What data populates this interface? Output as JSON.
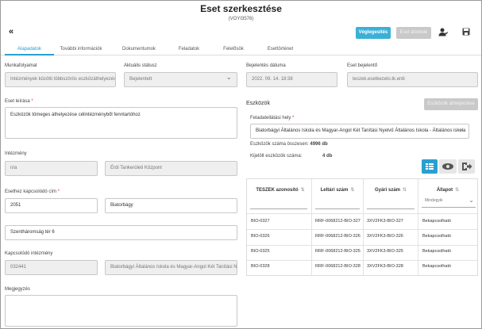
{
  "header": {
    "title": "Eset szerkesztése",
    "subtitle": "(VOYI3576)",
    "back_icon": "double-chevron-left-icon",
    "finalize_label": "Véglegesítés",
    "transfer_label": "Eset átvétele",
    "assign_icon": "user-assign-icon",
    "save_icon": "save-icon"
  },
  "tabs": [
    {
      "label": "Alapadatok",
      "active": true
    },
    {
      "label": "További információk"
    },
    {
      "label": "Dokumentumok"
    },
    {
      "label": "Feladatok"
    },
    {
      "label": "Felelősök"
    },
    {
      "label": "Esettörténet"
    }
  ],
  "form": {
    "workflow_label": "Munkafolyamat",
    "workflow_value": "Intézmények közötti többszörös eszközáthelyezés",
    "status_label": "Aktuális státusz",
    "status_value": "Bejelentett",
    "report_date_label": "Bejelentés dátuma",
    "report_date_value": "2022. 09. 14. 18:38",
    "reporter_label": "Eset bejelentő",
    "reporter_value": "teszek.esetkezelo.tk.erdi",
    "description_label": "Eset leírása",
    "description_required": "*",
    "description_value": "Eszközök tömeges áthelyezése célintézményből fenntartóhoz",
    "institution_label": "Intézmény",
    "institution_code": "n/a",
    "institution_name": "Érdi Tankerületi Központ",
    "address_label": "Esethez kapcsolódó cím",
    "address_required": "*",
    "zip_value": "2051",
    "city_value": "Biatorbágy",
    "street_value": "Szentháromság tér 6",
    "related_inst_label": "Kapcsolódó intézmény",
    "related_inst_code": "032441",
    "related_inst_name": "Biatorbágyi Általános Iskola és Magyar-Angol Két Tanítási Ny",
    "note_label": "Megjegyzés",
    "note_value": ""
  },
  "devices": {
    "section_title": "Eszközök",
    "move_button": "Eszközök áthelyezése",
    "site_label": "Feladatellátási hely",
    "site_required": "*",
    "site_value": "Biatorbágyi Általános Iskola és Magyar-Angol Két Tanítási Nyelvű Általános Iskola - Általános iskola",
    "total_label": "Eszközök száma összesen:",
    "total_value": "4996 db",
    "selected_label": "Kijelölt eszközök száma:",
    "selected_value": "4 db",
    "view_icons": [
      "table-view-icon",
      "eye-icon",
      "export-icon"
    ],
    "columns": [
      "TESZEK azonosító",
      "Leltári szám",
      "Gyári szám",
      "Állapot"
    ],
    "state_filter_placeholder": "Mindegyik",
    "rows": [
      [
        "BIO-0327",
        "RRF-0068212-BIO-327",
        "3XV2FK3-BIO-327",
        "Bekapcsolható"
      ],
      [
        "BIO-0326",
        "RRF-0068212-BIO-326",
        "3XV2FK3-BIO-326",
        "Bekapcsolható"
      ],
      [
        "BIO-0325",
        "RRF-0068212-BIO-325",
        "3XV2FK3-BIO-325",
        "Bekapcsolható"
      ],
      [
        "BIO-0328",
        "RRF-0068212-BIO-328",
        "3XV2FK3-BIO-328",
        "Bekapcsolható"
      ]
    ]
  },
  "colors": {
    "accent": "#2a9fd0",
    "primary_button": "#3bb0d6",
    "disabled_button": "#c9c9c9"
  }
}
